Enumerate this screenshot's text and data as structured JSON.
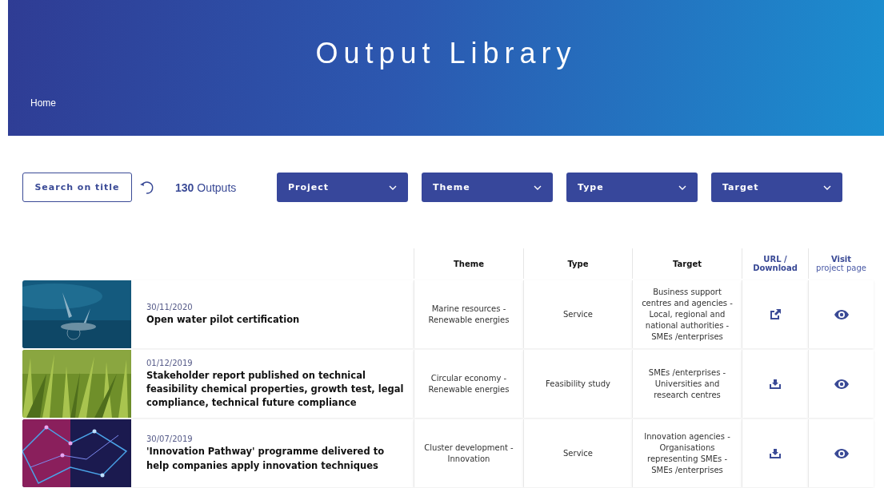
{
  "header": {
    "title": "Output Library",
    "breadcrumb": "Home"
  },
  "toolbar": {
    "search_button": "Search on title",
    "count": "130",
    "count_label": "Outputs",
    "filters": [
      "Project",
      "Theme",
      "Type",
      "Target"
    ]
  },
  "table": {
    "columns": [
      "Theme",
      "Type",
      "Target",
      "URL / Download"
    ],
    "visit_column": {
      "label": "Visit",
      "sublabel": "project page"
    },
    "rows": [
      {
        "date": "30/11/2020",
        "title": "Open water pilot certification",
        "theme": "Marine resources - Renewable energies",
        "type": "Service",
        "target": "Business support centres and agencies - Local, regional and national authorities - SMEs /enterprises",
        "link": {
          "kind": "url"
        }
      },
      {
        "date": "01/12/2019",
        "title": "Stakeholder report published on technical feasibility chemical properties, growth test, legal compliance, technical future compliance",
        "theme": "Circular economy - Renewable energies",
        "type": "Feasibility study",
        "target": "SMEs /enterprises - Universities and research centres",
        "link": {
          "kind": "download"
        }
      },
      {
        "date": "30/07/2019",
        "title": "'Innovation Pathway' programme delivered to help companies apply innovation techniques",
        "theme": "Cluster development - Innovation",
        "type": "Service",
        "target": "Innovation agencies - Organisations representing SMEs - SMEs /enterprises",
        "link": {
          "kind": "download"
        }
      }
    ]
  }
}
